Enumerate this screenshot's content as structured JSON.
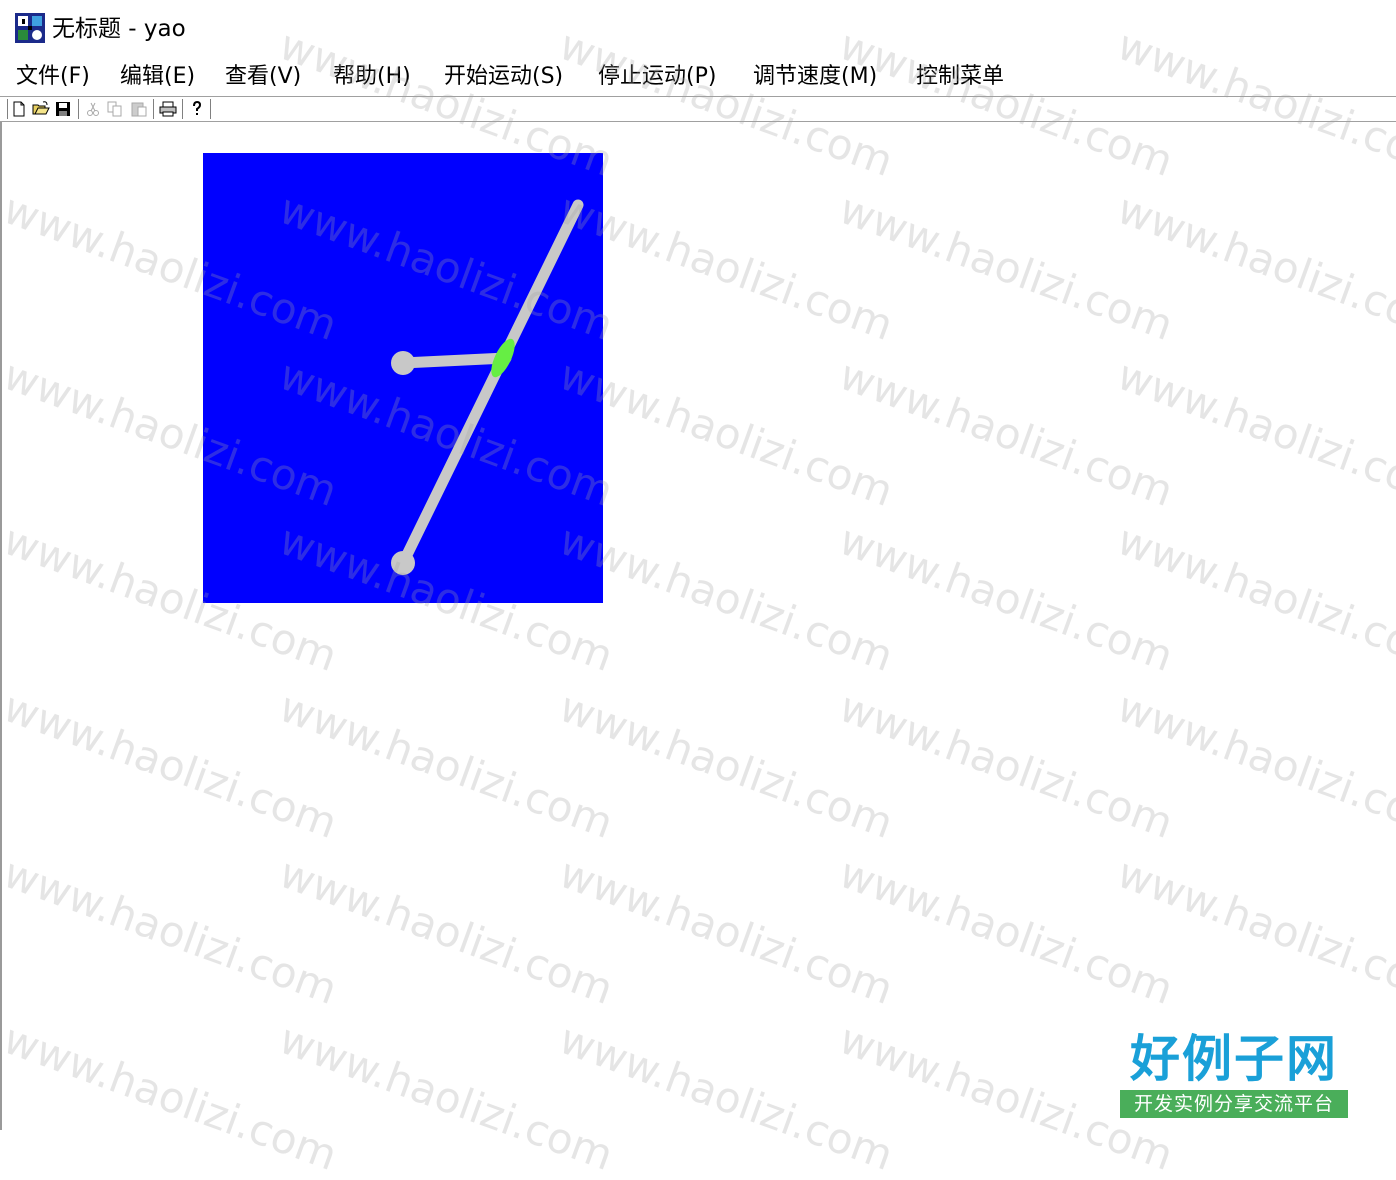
{
  "window": {
    "title": "无标题 - yao",
    "app_icon": "mfc-app-icon"
  },
  "menubar": {
    "items": [
      {
        "label": "文件(F)"
      },
      {
        "label": "编辑(E)"
      },
      {
        "label": "查看(V)"
      },
      {
        "label": "帮助(H)"
      },
      {
        "label": "开始运动(S)"
      },
      {
        "label": "停止运动(P)"
      },
      {
        "label": "调节速度(M)"
      },
      {
        "label": "控制菜单"
      }
    ]
  },
  "toolbar": {
    "buttons": [
      {
        "icon": "new-file-icon",
        "enabled": true
      },
      {
        "icon": "open-folder-icon",
        "enabled": true
      },
      {
        "icon": "save-icon",
        "enabled": true
      },
      {
        "icon": "cut-icon",
        "enabled": false
      },
      {
        "icon": "copy-icon",
        "enabled": false
      },
      {
        "icon": "paste-icon",
        "enabled": false
      },
      {
        "icon": "print-icon",
        "enabled": true
      },
      {
        "icon": "help-icon",
        "enabled": true
      }
    ]
  },
  "scene": {
    "background_color": "#0000ff",
    "link_color": "#c8c8c8",
    "joint_color": "#66ee44"
  },
  "watermark": {
    "text": "www.haolizi.com"
  },
  "logo": {
    "main": "好例子网",
    "sub": "开发实例分享交流平台"
  }
}
